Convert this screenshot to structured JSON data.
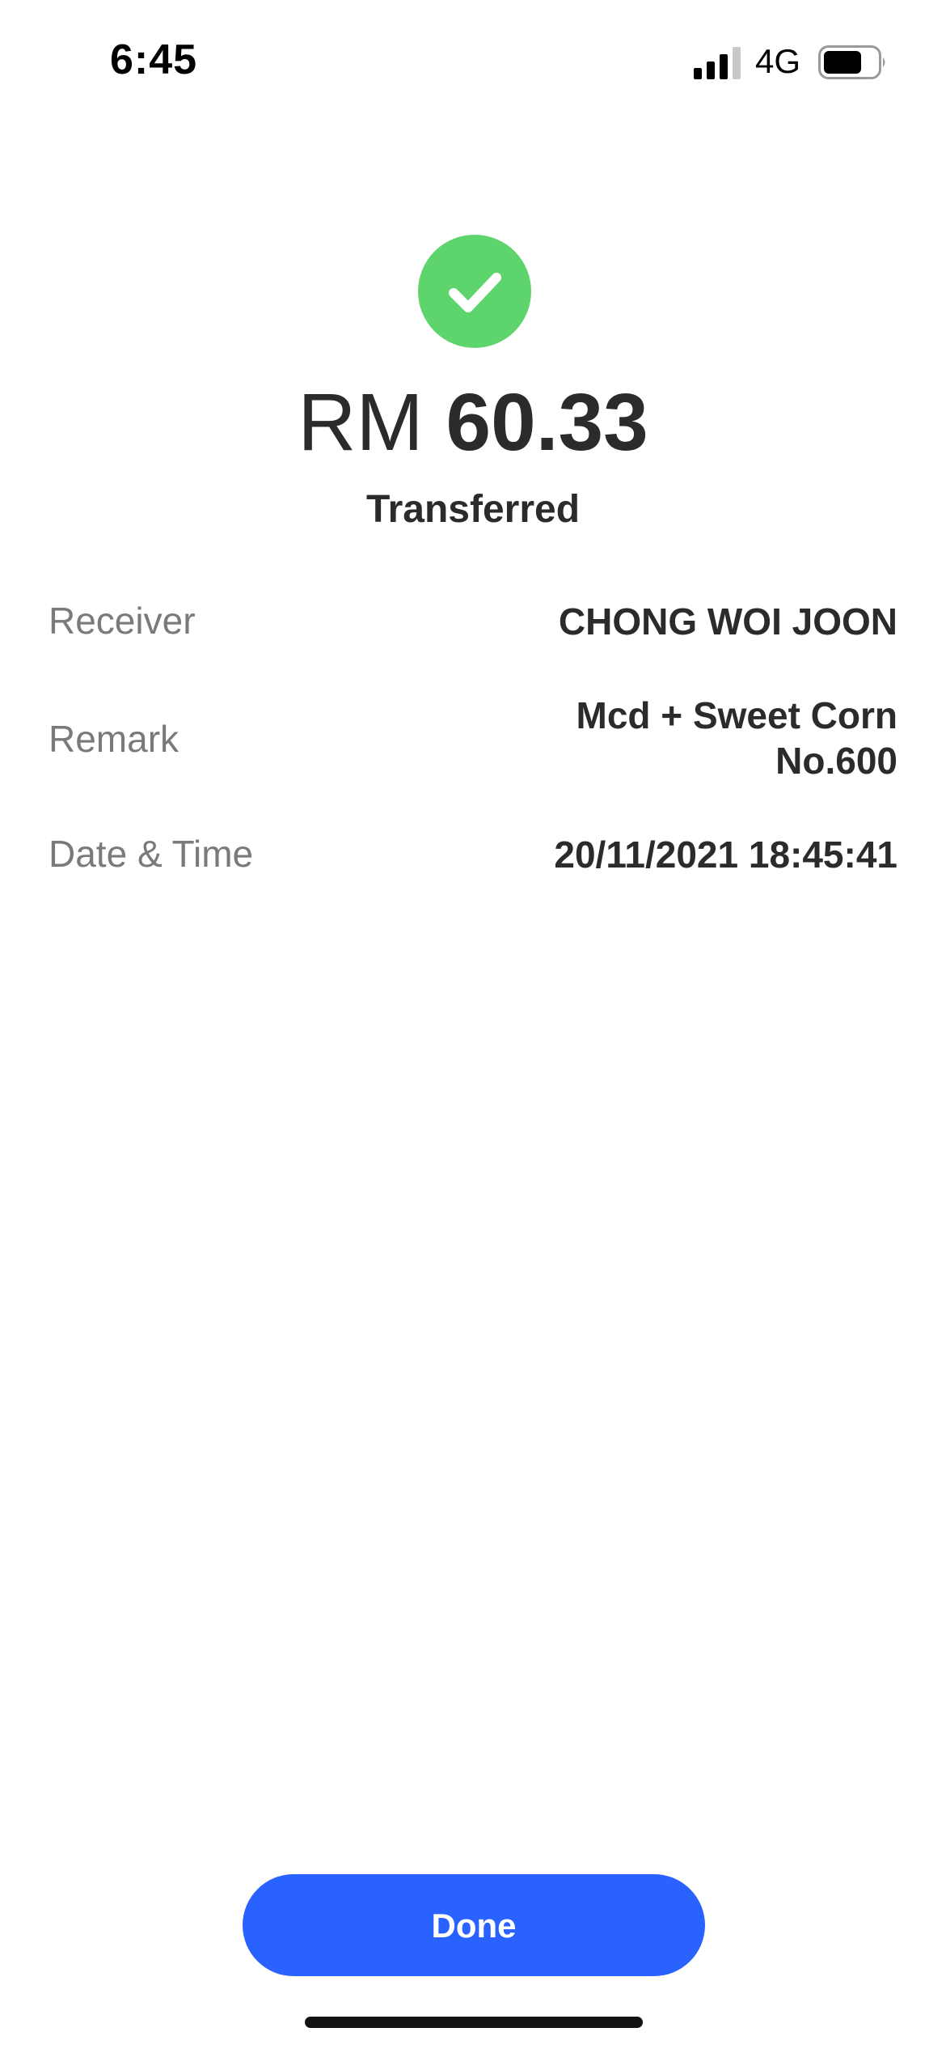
{
  "status_bar": {
    "time": "6:45",
    "network": "4G",
    "signal_icon": "cellular-signal-icon",
    "battery_icon": "battery-icon"
  },
  "receipt": {
    "status_icon": "checkmark-icon",
    "currency": "RM",
    "amount": "60.33",
    "status": "Transferred",
    "details": [
      {
        "label": "Receiver",
        "value": "CHONG WOI JOON"
      },
      {
        "label": "Remark",
        "value_line1": "Mcd + Sweet Corn",
        "value_line2": "No.600"
      },
      {
        "label": "Date & Time",
        "value": "20/11/2021 18:45:41"
      }
    ]
  },
  "actions": {
    "done_label": "Done"
  },
  "colors": {
    "success": "#5ed46d",
    "primary": "#2962ff"
  }
}
